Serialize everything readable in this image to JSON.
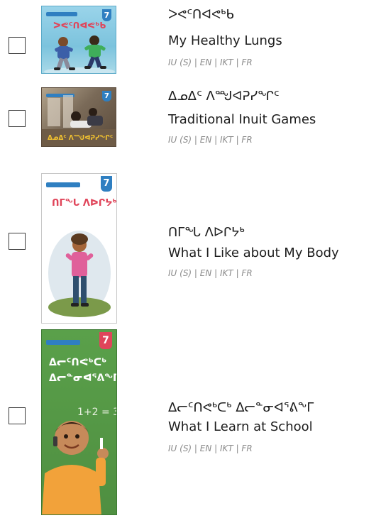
{
  "books": [
    {
      "syllabic_title": "ᐳᕙᑦᑎᐊᕙᒃᑲ",
      "english_title": "My Healthy Lungs",
      "languages": "IU (S) | EN | IKT | FR",
      "level": "7",
      "cover_title": "ᐳᕙᑦᑎᐊᕙᒃᑲ",
      "colors": {
        "cover_bg": "#7cc3dd",
        "badge": "#2f7fc1",
        "cover_text": "#e0455a"
      }
    },
    {
      "syllabic_title": "ᐃᓄᐃᑦ ᐱᙳᐊᕈᓯᖏᑦ",
      "english_title": "Traditional Inuit Games",
      "languages": "IU (S) | EN | IKT  | FR",
      "level": "7",
      "cover_title": "ᐃᓄᐃᑦ ᐱᙳᐊᕈᓯᖏᑦ",
      "colors": {
        "cover_bg": "#8a7a66",
        "badge": "#2f7fc1",
        "cover_text": "#f2c230"
      }
    },
    {
      "syllabic_title": "ᑎᒥᖓ ᐱᐅᒋᔭᒃ",
      "english_title": "What I Like about My Body",
      "languages": "IU (S) | EN | IKT | FR",
      "level": "7",
      "cover_title": "ᑎᒥᖓ ᐱᐅᒋᔭᒃ",
      "colors": {
        "cover_bg": "#ffffff",
        "badge": "#2f7fc1",
        "cover_text": "#e0455a"
      }
    },
    {
      "syllabic_title": "ᐃᓕᑦᑎᕙᒃᑕᒃ ᐃᓕᓐᓂᐊᕐᕕᖕᒥ",
      "english_title": "What I Learn at School",
      "languages": "IU (S) | EN | IKT  | FR",
      "level": "7",
      "cover_title_line1": "ᐃᓕᑦᑎᕙᒃᑕᒃ",
      "cover_title_line2": "ᐃᓕᓐᓂᐊᕐᕕᖕᒥ",
      "cover_equation": "1+2 = 3",
      "colors": {
        "cover_bg": "#5a9a4a",
        "badge": "#e0455a",
        "cover_text": "#ffffff"
      }
    }
  ]
}
